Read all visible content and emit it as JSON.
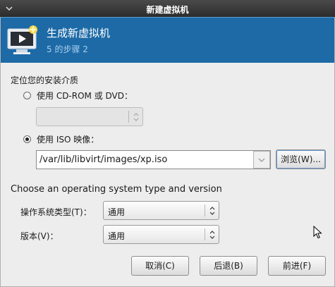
{
  "window": {
    "title": "新建虚拟机"
  },
  "banner": {
    "title": "生成新虚拟机",
    "step": "5 的步骤 2"
  },
  "install_media": {
    "section_label": "定位您的安装介质",
    "cdrom_option": {
      "label": "使用 CD-ROM 或 DVD：",
      "selected": false
    },
    "cdrom_combo": {
      "value": "",
      "enabled": false
    },
    "iso_option": {
      "label": "使用 ISO 映像：",
      "selected": true
    },
    "iso_path": "/var/lib/libvirt/images/xp.iso",
    "browse_label": "浏览(W)..."
  },
  "os": {
    "heading": "Choose an operating system type and version",
    "type_label": "操作系统类型(T)：",
    "type_value": "通用",
    "version_label": "版本(V)：",
    "version_value": "通用"
  },
  "buttons": {
    "cancel": "取消(C)",
    "back": "后退(B)",
    "forward": "前进(F)"
  },
  "colors": {
    "banner": "#1d6aa6",
    "titlebar": "#333333"
  }
}
